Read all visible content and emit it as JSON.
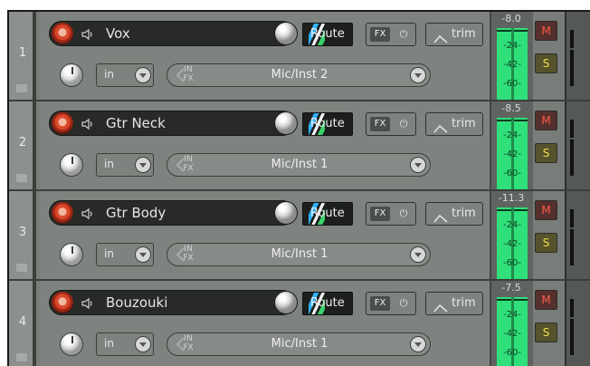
{
  "tracks": [
    {
      "number": "1",
      "name": "Vox",
      "route_label": "Route",
      "fx_label": "FX",
      "trim_label": "trim",
      "input_mode": "in",
      "input_source": "Mic/Inst 2",
      "peak": "-8.0",
      "meter_ticks": [
        "-24-",
        "-42-",
        "-60-"
      ],
      "mute_label": "M",
      "solo_label": "S"
    },
    {
      "number": "2",
      "name": "Gtr Neck",
      "route_label": "Route",
      "fx_label": "FX",
      "trim_label": "trim",
      "input_mode": "in",
      "input_source": "Mic/Inst 1",
      "peak": "-8.5",
      "meter_ticks": [
        "-24-",
        "-42-",
        "-60-"
      ],
      "mute_label": "M",
      "solo_label": "S"
    },
    {
      "number": "3",
      "name": "Gtr Body",
      "route_label": "Route",
      "fx_label": "FX",
      "trim_label": "trim",
      "input_mode": "in",
      "input_source": "Mic/Inst 1",
      "peak": "-11.3",
      "meter_ticks": [
        "-24-",
        "-42-",
        "-60-"
      ],
      "mute_label": "M",
      "solo_label": "S"
    },
    {
      "number": "4",
      "name": "Bouzouki",
      "route_label": "Route",
      "fx_label": "FX",
      "trim_label": "trim",
      "input_mode": "in",
      "input_source": "Mic/Inst 1",
      "peak": "-7.5",
      "meter_ticks": [
        "-24-",
        "-42-",
        "-60-"
      ],
      "mute_label": "M",
      "solo_label": "S"
    }
  ],
  "input_fx_label": "IN FX",
  "colors": {
    "meter": "#2fe07a",
    "record": "#d9472a",
    "mute": "#ff5a4a",
    "solo": "#f2e04a"
  },
  "icons": {
    "record": "record-arm-icon",
    "speaker": "speaker-icon",
    "power": "power-icon",
    "trim": "envelope-icon",
    "dropdown": "chevron-down-icon"
  }
}
